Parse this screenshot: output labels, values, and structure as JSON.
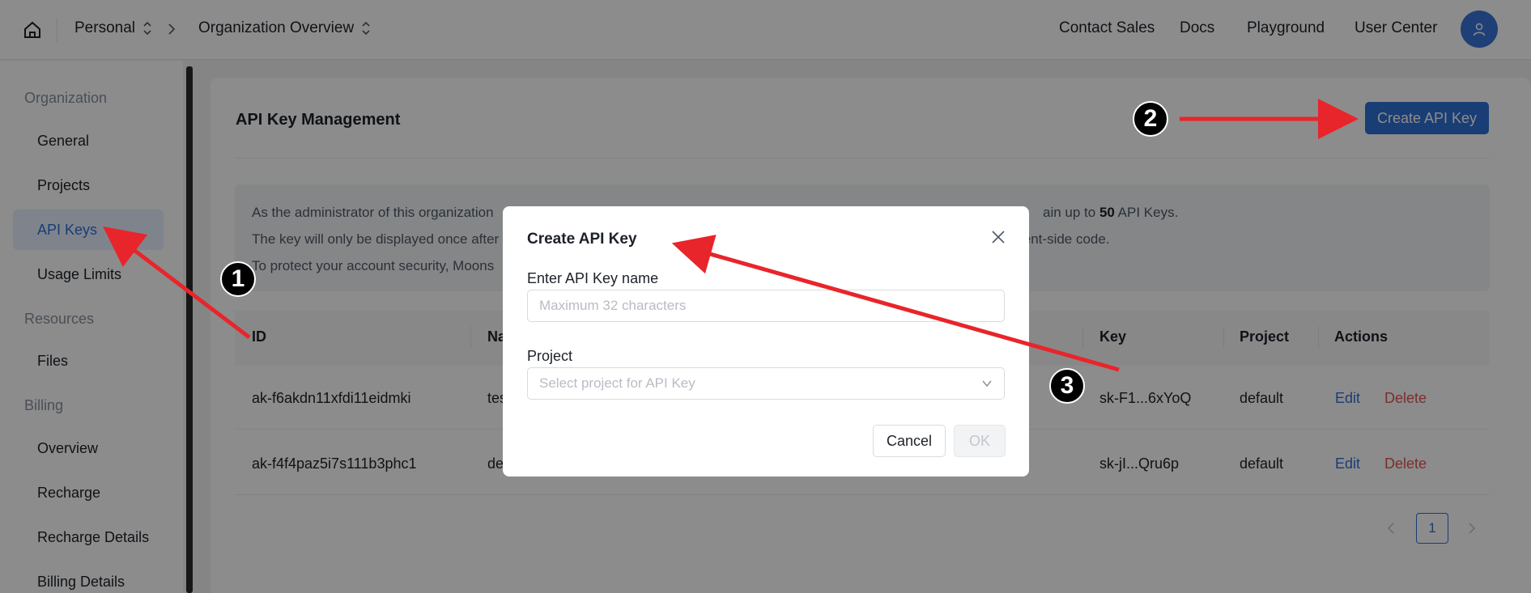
{
  "topbar": {
    "workspace": "Personal",
    "section": "Organization Overview",
    "links": [
      "Contact Sales",
      "Docs",
      "Playground",
      "User Center"
    ]
  },
  "sidebar": {
    "groups": {
      "organization": "Organization",
      "resources": "Resources",
      "billing": "Billing"
    },
    "items": {
      "general": "General",
      "projects": "Projects",
      "api_keys": "API Keys",
      "usage_limits": "Usage Limits",
      "files": "Files",
      "overview": "Overview",
      "recharge": "Recharge",
      "recharge_details": "Recharge Details",
      "billing_details": "Billing Details"
    },
    "active": "API Keys"
  },
  "main": {
    "title": "API Key Management",
    "create_button": "Create API Key",
    "notice": {
      "line1_left": "As the administrator of this organization",
      "line1_right_pre": "ain up to ",
      "line1_bold": "50",
      "line1_right_post": " API Keys.",
      "line2_left": "The key will only be displayed once after",
      "line2_right": "ient-side code.",
      "line3_left": "To protect your account security, Moons"
    },
    "table": {
      "headers": {
        "id": "ID",
        "name": "Na",
        "key": "Key",
        "project": "Project",
        "actions": "Actions"
      },
      "rows": [
        {
          "id": "ak-f6akdn11xfdi11eidmki",
          "name": "tes",
          "key": "sk-F1...6xYoQ",
          "project": "default",
          "edit": "Edit",
          "delete": "Delete"
        },
        {
          "id": "ak-f4f4paz5i7s111b3phc1",
          "name": "de",
          "key": "sk-jI...Qru6p",
          "project": "default",
          "edit": "Edit",
          "delete": "Delete"
        }
      ]
    },
    "pagination": {
      "current": "1"
    }
  },
  "modal": {
    "title": "Create API Key",
    "name_label": "Enter API Key name",
    "name_placeholder": "Maximum 32 characters",
    "name_value": "",
    "project_label": "Project",
    "project_placeholder": "Select project for API Key",
    "cancel": "Cancel",
    "ok": "OK"
  },
  "annotations": {
    "badges": [
      "1",
      "2",
      "3"
    ],
    "arrow_color": "#e8252a"
  },
  "colors": {
    "accent": "#2f6fd6",
    "danger": "#e05555"
  },
  "icons": {
    "home": "home-icon",
    "avatar": "user-icon",
    "close": "close-icon",
    "select": "chevron-down-icon"
  }
}
